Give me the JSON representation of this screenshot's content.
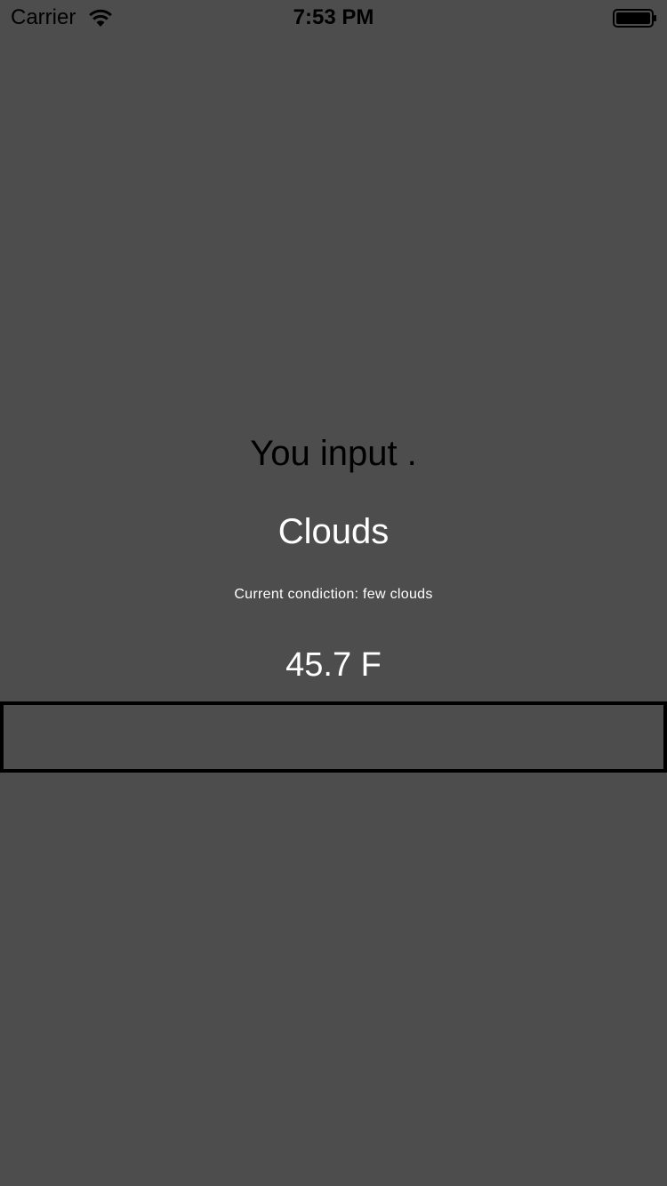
{
  "status_bar": {
    "carrier": "Carrier",
    "time": "7:53 PM",
    "icons": [
      "wifi-icon",
      "battery-icon"
    ]
  },
  "main": {
    "input_echo": "You input .",
    "condition": "Clouds",
    "condition_detail": "Current condiction: few clouds",
    "temperature": "45.7 F"
  },
  "text_field": {
    "value": "",
    "placeholder": ""
  },
  "colors": {
    "background": "#4d4d4d",
    "primary_text": "#ffffff",
    "dark_text": "#000000",
    "field_border": "#000000"
  }
}
